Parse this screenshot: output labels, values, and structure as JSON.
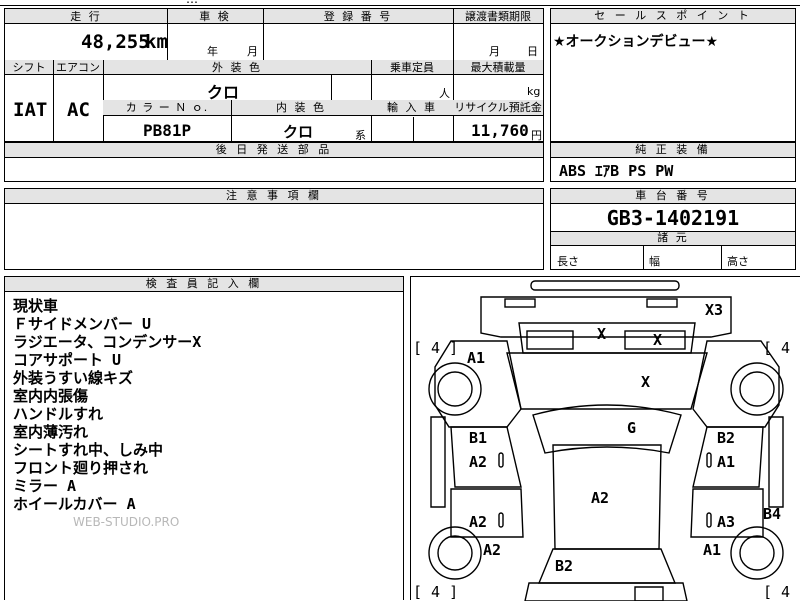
{
  "top_fragment": "…",
  "mileage": {
    "label": "走 行",
    "value": "48,255",
    "unit": "km"
  },
  "inspection": {
    "label": "車 検",
    "year_unit": "年",
    "month_unit": "月"
  },
  "registration": {
    "label": "登 録 番 号"
  },
  "transfer_docs": {
    "label": "譲渡書類期限",
    "month_unit": "月",
    "day_unit": "日"
  },
  "shift": {
    "label": "シフト",
    "value": "IAT"
  },
  "aircon": {
    "label": "エアコン",
    "value": "AC"
  },
  "exterior_color": {
    "label": "外 装 色",
    "value": "クロ"
  },
  "capacity": {
    "label": "乗車定員",
    "unit": "人"
  },
  "max_load": {
    "label": "最大積載量",
    "unit": "kg"
  },
  "color_no": {
    "label": "カ ラ ー Ｎ ｏ.",
    "value": "PB81P"
  },
  "interior_color": {
    "label": "内 装 色",
    "value": "クロ",
    "suffix": "系"
  },
  "import": {
    "label": "輸 入 車"
  },
  "recycle": {
    "label": "リサイクル預託金",
    "value": "11,760",
    "unit": "円"
  },
  "later_parts": {
    "label": "後 日 発 送 部 品"
  },
  "sales_point": {
    "label": "セ ー ル ス ポ イ ン ト",
    "text": "★オークションデビュー★"
  },
  "equipment": {
    "label": "純 正 装 備",
    "text": "ABS ｴｱB PS PW"
  },
  "notes": {
    "label": "注 意 事 項 欄"
  },
  "chassis": {
    "label": "車 台 番 号",
    "value": "GB3-1402191"
  },
  "dimensions": {
    "label": "諸 元",
    "length": "長さ",
    "width": "幅",
    "height": "高さ"
  },
  "inspector": {
    "label": "検 査 員 記 入 欄",
    "remarks": [
      "現状車",
      "Ｆサイドメンバー U",
      "ラジエータ、コンデンサーX",
      "コアサポート U",
      "外装うすい線キズ",
      "室内内張傷",
      "ハンドルすれ",
      "室内薄汚れ",
      "シートすれ中、しみ中",
      "フロント廻り押され",
      "ミラー A",
      "ホイールカバー A"
    ],
    "watermark": "WEB-STUDIO.PRO"
  },
  "diagram": {
    "tire_marks": [
      "[ 4 ]",
      "[ 4 ]",
      "[ 4 ]",
      "[ 4 ]"
    ],
    "marks": [
      "X3",
      "X",
      "X",
      "X",
      "A1",
      "G",
      "B1",
      "B2",
      "A2",
      "A1",
      "A2",
      "A2",
      "A3",
      "B4",
      "A2",
      "A1",
      "B2"
    ]
  },
  "colors": {
    "header_bg": "#e4e4e4",
    "line": "#000000"
  }
}
